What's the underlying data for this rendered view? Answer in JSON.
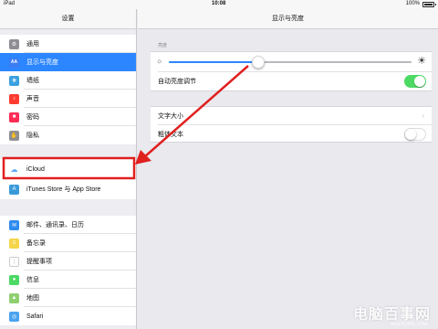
{
  "status_bar": {
    "carrier": "iPad",
    "time": "10:08",
    "battery": "100%"
  },
  "sidebar": {
    "title": "设置",
    "groups": [
      [
        {
          "label": "通用",
          "icon": "gear-icon"
        },
        {
          "label": "显示与亮度",
          "icon": "display-icon",
          "icon_text": "AA",
          "selected": true
        },
        {
          "label": "墙纸",
          "icon": "wallpaper-icon"
        },
        {
          "label": "声音",
          "icon": "sound-icon"
        },
        {
          "label": "密码",
          "icon": "lock-icon"
        },
        {
          "label": "隐私",
          "icon": "privacy-hand-icon"
        }
      ],
      [
        {
          "label": "iCloud",
          "icon": "icloud-icon"
        },
        {
          "label": "iTunes Store 与 App Store",
          "icon": "app-store-icon"
        }
      ],
      [
        {
          "label": "邮件、通讯录、日历",
          "icon": "mail-icon"
        },
        {
          "label": "备忘录",
          "icon": "notes-icon"
        },
        {
          "label": "提醒事项",
          "icon": "reminders-icon"
        },
        {
          "label": "信息",
          "icon": "messages-icon"
        },
        {
          "label": "地图",
          "icon": "maps-icon"
        },
        {
          "label": "Safari",
          "icon": "safari-icon"
        }
      ]
    ]
  },
  "main": {
    "title": "显示与亮度",
    "brightness": {
      "caption": "亮度",
      "level": 0.37,
      "auto_label": "自动亮度调节",
      "auto_on": true
    },
    "text": {
      "size_label": "文字大小",
      "bold_label": "粗体文本",
      "bold_on": false
    }
  },
  "annotation": {
    "box_color": "#e0201f",
    "arrow_color": "#e0201f"
  },
  "watermark": {
    "text": "电脑百事网",
    "sub": "www.PC841.COM"
  },
  "colors": {
    "accent": "#2c86ff",
    "toggle_on": "#4cd964"
  }
}
